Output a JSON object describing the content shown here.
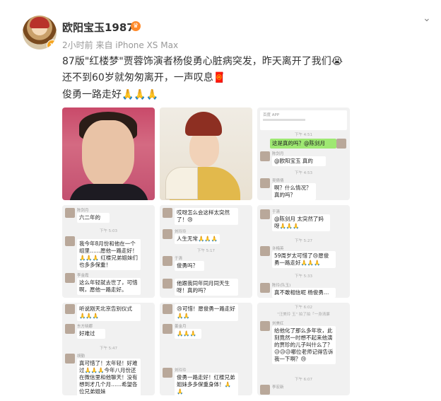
{
  "post": {
    "username": "欧阳宝玉1987",
    "meta": "2小时前  来自 iPhone XS Max",
    "lines": [
      "87版\"红楼梦\"贾蓉饰演者杨俊勇心脏病突发，昨天离开了我们😭",
      "还不到60岁就匆匆离开，一声叹息🧧",
      "俊勇一路走好🙏🙏🙏"
    ]
  },
  "icons": {
    "verified": "v-badge-icon",
    "crown": "crown-icon",
    "chevron": "chevron-down-icon"
  },
  "cells": {
    "c3": {
      "banner": "百度 APP",
      "time1": "下午 4:51",
      "me": "这是真的吗？@陈剑月",
      "name1": "陈剑月",
      "msg1": "@欧阳宝玉 真的",
      "time2": "下午 4:53",
      "name2": "吴倩倩",
      "msg2": "啊？什么情况？真的吗？"
    },
    "c4": {
      "name1": "陈剑月",
      "msg1": "六二年的",
      "time1": "下午 5:03",
      "msg2": "我今年8月份和他在一个组里……愿他一路走好！🙏🙏🙏 红楼兄弟姐妹们也多多保重！",
      "name3": "李金霞",
      "msg3": "这么年轻就去世了，可惜啊，愿他一路走好。"
    },
    "c5": {
      "msg1": "哎呀怎么会这样太突然了！😢",
      "name2": "刘玲玲",
      "msg2": "人生无常🙏🙏🙏",
      "time1": "下午 5:17",
      "name3": "于清",
      "msg3": "俊勇吗？",
      "msg4": "他跟我同年同月同天生呀！真的吗？"
    },
    "c6": {
      "name1": "于清",
      "msg1": "@陈剑月 太突然了妈呀🙏🙏🙏",
      "time1": "下午 5:27",
      "name2": "许梅英",
      "msg2": "59周岁太可惜了😢愿俊勇一路走好🙏🙏🙏",
      "time2": "下午 5:33",
      "name3": "陈玲(队玉)",
      "msg3": "真不敢相信呢 杨俊勇…"
    },
    "c7": {
      "msg1": "听说刚天北京告别仪式🙏🙏🙏",
      "name2": "东方晓娜",
      "msg2": "好难过",
      "time1": "下午 5:47",
      "name3": "胡勤",
      "msg3": "真可惜了！太年轻！好难过🙏🙏🙏今年八月份还在微信里和他聊天！没有想到才几个月……希望各位兄弟姐妹"
    },
    "c8": {
      "msg1": "😢可惜！愿俊勇一路走好🙏🙏",
      "name2": "姜金月",
      "msg2": "🙏🙏🙏",
      "name3": "刘玲玲",
      "msg3": "俊勇一路走好！红楼兄弟姐妹多多保重身体！🙏🙏"
    },
    "c9": {
      "time1": "下午 6:02",
      "sys": "\"汪美玲 玉\" 拍了拍「一身清廉",
      "name2": "刘美红",
      "msg2": "给他化了那么多年妆，此刻竟然一时想不起来他演的贾珍的儿子叫什么了？😥😥😥哪位老师记得告诉我一下啊？😢",
      "time2": "下午 6:07",
      "name3": "李宏新"
    }
  }
}
